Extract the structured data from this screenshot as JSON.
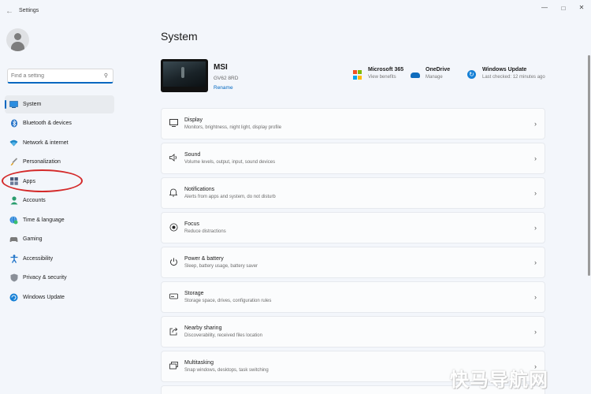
{
  "window": {
    "title": "Settings",
    "back_icon": "back-arrow-icon",
    "controls": [
      "minimize-icon",
      "maximize-icon",
      "close-icon"
    ]
  },
  "sidebar": {
    "search_placeholder": "Find a setting",
    "items": [
      {
        "label": "System",
        "icon": "system-icon",
        "active": true
      },
      {
        "label": "Bluetooth & devices",
        "icon": "bluetooth-icon"
      },
      {
        "label": "Network & internet",
        "icon": "wifi-icon"
      },
      {
        "label": "Personalization",
        "icon": "brush-icon"
      },
      {
        "label": "Apps",
        "icon": "apps-icon",
        "highlighted": true
      },
      {
        "label": "Accounts",
        "icon": "accounts-icon"
      },
      {
        "label": "Time & language",
        "icon": "globe-clock-icon"
      },
      {
        "label": "Gaming",
        "icon": "gamepad-icon"
      },
      {
        "label": "Accessibility",
        "icon": "accessibility-icon"
      },
      {
        "label": "Privacy & security",
        "icon": "shield-icon"
      },
      {
        "label": "Windows Update",
        "icon": "windows-update-icon"
      }
    ]
  },
  "main": {
    "title": "System",
    "device": {
      "name": "MSI",
      "model": "GV62 8RD",
      "rename_label": "Rename"
    },
    "quick_links": [
      {
        "title": "Microsoft 365",
        "subtitle": "View benefits",
        "icon": "microsoft-logo-icon"
      },
      {
        "title": "OneDrive",
        "subtitle": "Manage",
        "icon": "onedrive-cloud-icon"
      },
      {
        "title": "Windows Update",
        "subtitle": "Last checked: 12 minutes ago",
        "icon": "windows-update-icon"
      }
    ],
    "cards": [
      {
        "title": "Display",
        "subtitle": "Monitors, brightness, night light, display profile",
        "icon": "monitor-icon"
      },
      {
        "title": "Sound",
        "subtitle": "Volume levels, output, input, sound devices",
        "icon": "speaker-icon"
      },
      {
        "title": "Notifications",
        "subtitle": "Alerts from apps and system, do not disturb",
        "icon": "bell-icon"
      },
      {
        "title": "Focus",
        "subtitle": "Reduce distractions",
        "icon": "focus-icon"
      },
      {
        "title": "Power & battery",
        "subtitle": "Sleep, battery usage, battery saver",
        "icon": "power-icon"
      },
      {
        "title": "Storage",
        "subtitle": "Storage space, drives, configuration rules",
        "icon": "storage-drive-icon"
      },
      {
        "title": "Nearby sharing",
        "subtitle": "Discoverability, received files location",
        "icon": "share-icon"
      },
      {
        "title": "Multitasking",
        "subtitle": "Snap windows, desktops, task switching",
        "icon": "multitasking-icon"
      }
    ]
  },
  "colors": {
    "accent": "#0067c0",
    "highlight_ring": "#d42a2a",
    "background": "#f3f6fb"
  },
  "watermark": "快马导航网"
}
